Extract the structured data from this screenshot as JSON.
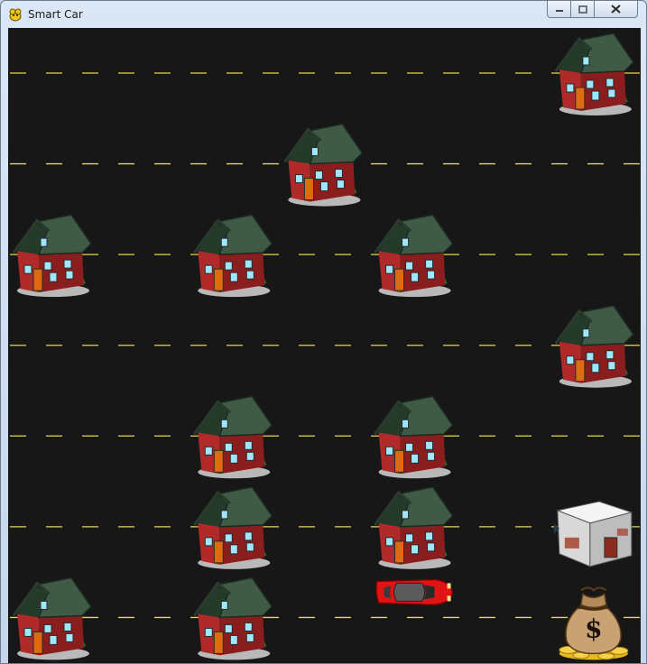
{
  "window": {
    "title": "Smart Car",
    "app_icon": "pygame-snake-icon",
    "controls": {
      "minimize_icon": "minimize-icon",
      "maximize_icon": "maximize-icon",
      "close_icon": "close-icon"
    }
  },
  "game": {
    "grid": {
      "columns": 7,
      "rows": 7
    },
    "road_color": "#171717",
    "lane_marking_color": "#e3d65a",
    "houses": [
      {
        "col": 6,
        "row": 0
      },
      {
        "col": 3,
        "row": 1
      },
      {
        "col": 0,
        "row": 2
      },
      {
        "col": 2,
        "row": 2
      },
      {
        "col": 4,
        "row": 2
      },
      {
        "col": 6,
        "row": 3
      },
      {
        "col": 2,
        "row": 4
      },
      {
        "col": 4,
        "row": 4
      },
      {
        "col": 2,
        "row": 5
      },
      {
        "col": 4,
        "row": 5
      },
      {
        "col": 0,
        "row": 6
      },
      {
        "col": 2,
        "row": 6
      }
    ],
    "car": {
      "col": 4,
      "row": 6,
      "color": "#e01414"
    },
    "bunker": {
      "col": 6,
      "row": 5
    },
    "goal": {
      "col": 6,
      "row": 6,
      "icon": "money-bag-icon",
      "symbol": "$"
    }
  }
}
